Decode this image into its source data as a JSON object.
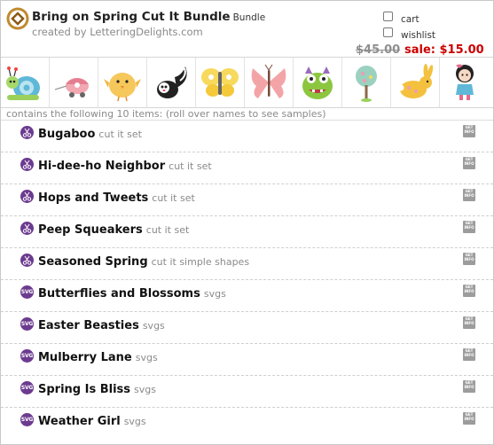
{
  "bundle": {
    "title": "Bring on Spring Cut It Bundle",
    "badge": "Bundle",
    "creator": "created by LetteringDelights.com",
    "cart_label": "cart",
    "wishlist_label": "wishlist",
    "old_price": "$45.00",
    "sale_price": "sale: $15.00",
    "contains_text": "contains the following 10 items: (roll over names to see samples)"
  },
  "colors": {
    "sale": "#cc0000",
    "icon_purple": "#6c3b8f"
  },
  "thumbnails": [
    "snail",
    "camper-bug",
    "chick",
    "skunk",
    "butterfly-yellow",
    "butterfly-pink",
    "green-monster",
    "tree",
    "bunny",
    "girl"
  ],
  "items": [
    {
      "name": "Bugaboo",
      "type": "cut it set",
      "icon": "scissors-icon",
      "info": "GET INFO"
    },
    {
      "name": "Hi-dee-ho Neighbor",
      "type": "cut it set",
      "icon": "scissors-icon",
      "info": "GET INFO"
    },
    {
      "name": "Hops and Tweets",
      "type": "cut it set",
      "icon": "scissors-icon",
      "info": "GET INFO"
    },
    {
      "name": "Peep Squeakers",
      "type": "cut it set",
      "icon": "scissors-icon",
      "info": "GET INFO"
    },
    {
      "name": "Seasoned Spring",
      "type": "cut it simple shapes",
      "icon": "scissors-icon",
      "info": "GET INFO"
    },
    {
      "name": "Butterflies and Blossoms",
      "type": "svgs",
      "icon": "svg-icon",
      "info": "GET INFO",
      "svg_text": "SVG"
    },
    {
      "name": "Easter Beasties",
      "type": "svgs",
      "icon": "svg-icon",
      "info": "GET INFO",
      "svg_text": "SVG"
    },
    {
      "name": "Mulberry Lane",
      "type": "svgs",
      "icon": "svg-icon",
      "info": "GET INFO",
      "svg_text": "SVG"
    },
    {
      "name": "Spring Is Bliss",
      "type": "svgs",
      "icon": "svg-icon",
      "info": "GET INFO",
      "svg_text": "SVG"
    },
    {
      "name": "Weather Girl",
      "type": "svgs",
      "icon": "svg-icon",
      "info": "GET INFO",
      "svg_text": "SVG"
    }
  ]
}
